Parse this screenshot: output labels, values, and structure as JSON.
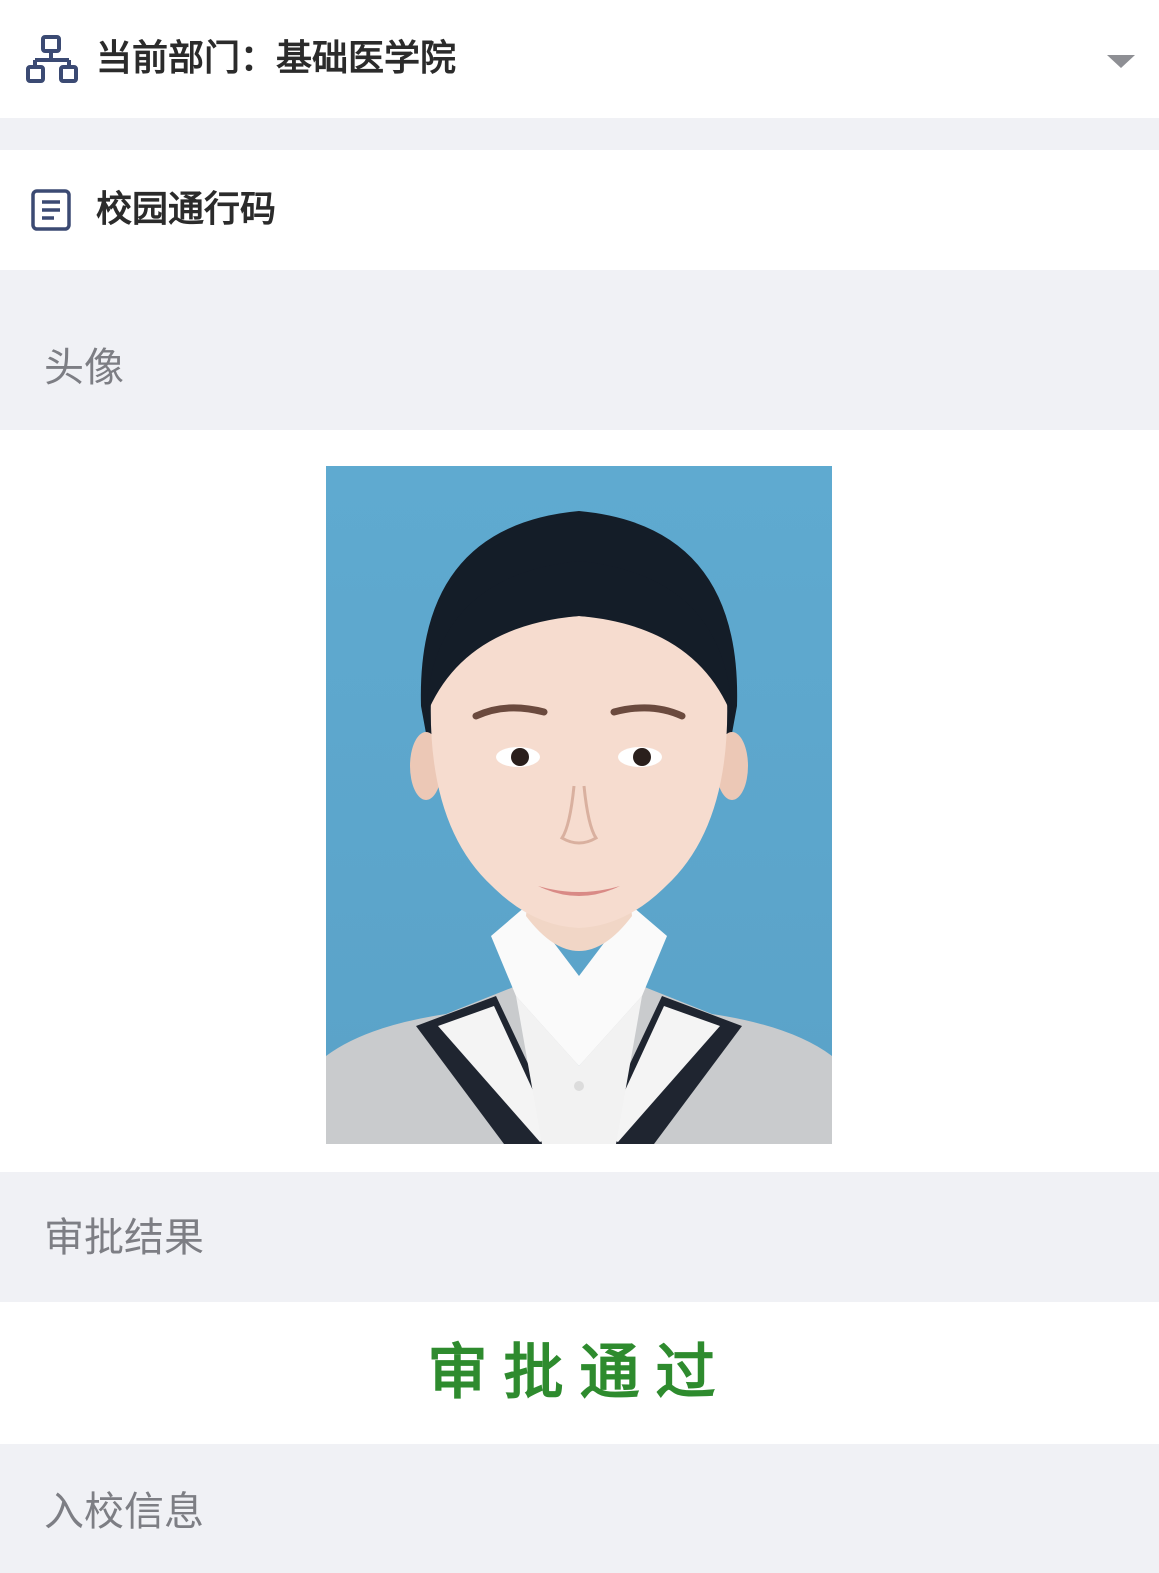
{
  "department": {
    "prefix": "当前部门：",
    "name": "基础医学院",
    "icon": "org-structure-icon",
    "dropdown_icon": "caret-down-icon"
  },
  "pass": {
    "title": "校园通行码",
    "icon": "document-list-icon"
  },
  "avatar": {
    "label": "头像",
    "photo_alt": "ID photo portrait"
  },
  "approval": {
    "label": "审批结果",
    "result": "审批通过",
    "result_color": "#2e8b2e"
  },
  "entry_info": {
    "label": "入校信息"
  },
  "colors": {
    "background_grey": "#f0f1f5",
    "icon_blue": "#3b4a73",
    "label_grey": "#7d7e84",
    "photo_background": "#5ea7cd"
  }
}
